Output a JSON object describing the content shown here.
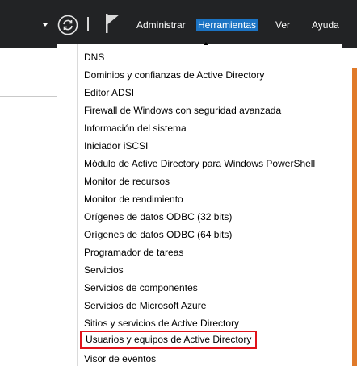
{
  "toolbar": {
    "dropdown_icon": "chevron-down-icon",
    "refresh_icon": "refresh-icon",
    "flag_icon": "flag-icon"
  },
  "menu": {
    "items": [
      {
        "label": "Administrar"
      },
      {
        "label": "Herramientas",
        "active": true
      },
      {
        "label": "Ver"
      },
      {
        "label": "Ayuda"
      }
    ]
  },
  "tools_menu": {
    "items": [
      "DNS",
      "Dominios y confianzas de Active Directory",
      "Editor ADSI",
      "Firewall de Windows con seguridad avanzada",
      "Información del sistema",
      "Iniciador iSCSI",
      "Módulo de Active Directory para Windows PowerShell",
      "Monitor de recursos",
      "Monitor de rendimiento",
      "Orígenes de datos ODBC (32 bits)",
      "Orígenes de datos ODBC (64 bits)",
      "Programador de tareas",
      "Servicios",
      "Servicios de componentes",
      "Servicios de Microsoft Azure",
      "Sitios y servicios de Active Directory",
      "Usuarios y equipos de Active Directory",
      "Visor de eventos"
    ],
    "highlighted_index": 16
  },
  "colors": {
    "menubar": "#222325",
    "active_menu": "#1c74c4",
    "highlight_border": "#e0121a",
    "accent": "#e07a2a"
  }
}
